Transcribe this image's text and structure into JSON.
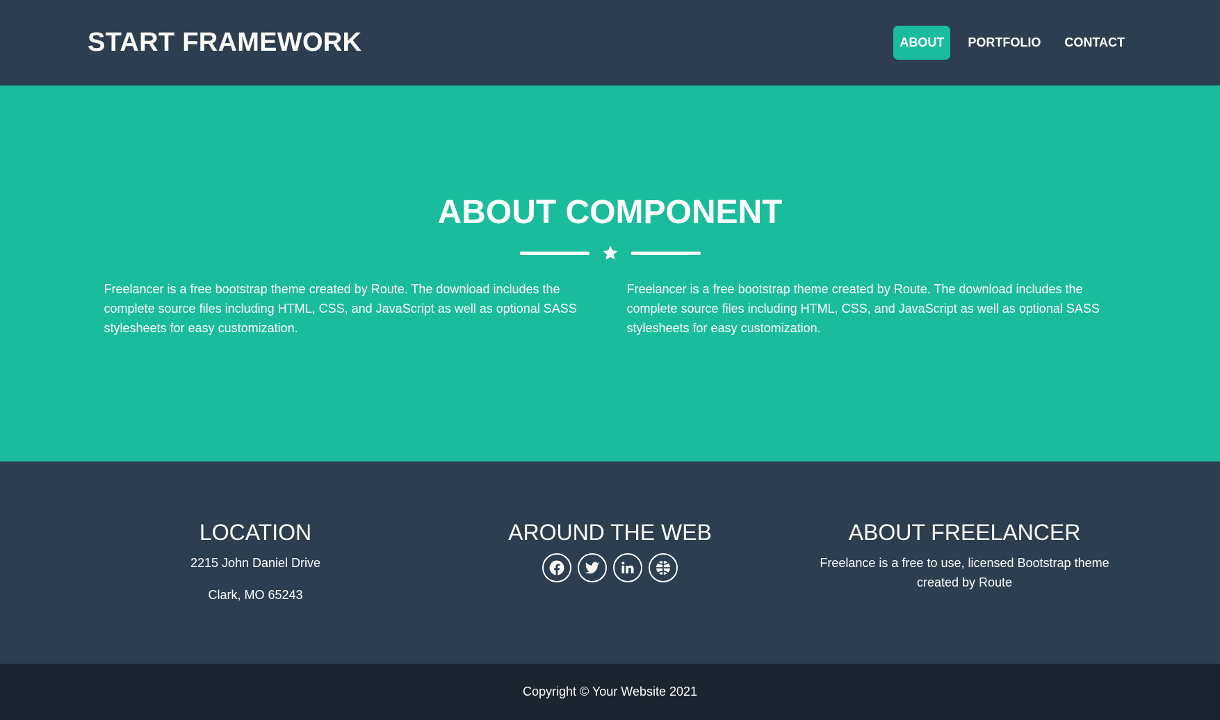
{
  "navbar": {
    "brand": "START FRAMEWORK",
    "links": [
      {
        "label": "ABOUT",
        "active": true
      },
      {
        "label": "PORTFOLIO",
        "active": false
      },
      {
        "label": "CONTACT",
        "active": false
      }
    ]
  },
  "about": {
    "title": "ABOUT COMPONENT",
    "divider_icon": "star-icon",
    "columns": [
      "Freelancer is a free bootstrap theme created by Route. The download includes the complete source files including HTML, CSS, and JavaScript as well as optional SASS stylesheets for easy customization.",
      "Freelancer is a free bootstrap theme created by Route. The download includes the complete source files including HTML, CSS, and JavaScript as well as optional SASS stylesheets for easy customization."
    ]
  },
  "footer": {
    "location": {
      "heading": "LOCATION",
      "line1": "2215 John Daniel Drive",
      "line2": "Clark, MO 65243"
    },
    "web": {
      "heading": "AROUND THE WEB",
      "icons": [
        "facebook-icon",
        "twitter-icon",
        "linkedin-icon",
        "dribbble-icon"
      ]
    },
    "about_freelancer": {
      "heading": "ABOUT FREELANCER",
      "text": "Freelance is a free to use, licensed Bootstrap theme created by Route"
    }
  },
  "copyright": "Copyright © Your Website 2021",
  "colors": {
    "primary": "#2c3e50",
    "accent": "#1abc9c",
    "copyright_bg": "#1a252f",
    "text": "#ffffff"
  }
}
